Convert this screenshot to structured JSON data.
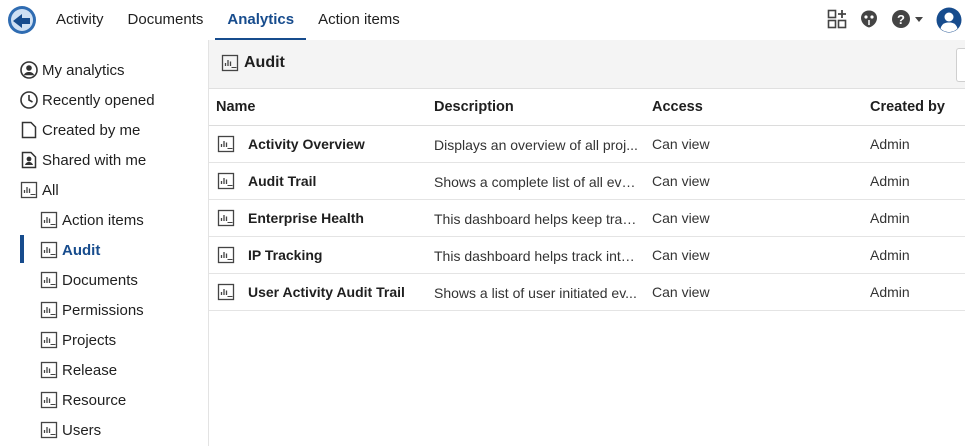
{
  "nav": {
    "tabs": [
      {
        "label": "Activity"
      },
      {
        "label": "Documents"
      },
      {
        "label": "Analytics"
      },
      {
        "label": "Action items"
      }
    ],
    "active_tab": "Analytics"
  },
  "sidebar": {
    "items": [
      {
        "label": "My analytics",
        "icon": "person-circle-icon"
      },
      {
        "label": "Recently opened",
        "icon": "clock-icon"
      },
      {
        "label": "Created by me",
        "icon": "document-icon"
      },
      {
        "label": "Shared with me",
        "icon": "shared-document-icon"
      },
      {
        "label": "All",
        "icon": "dashboard-icon"
      },
      {
        "label": "Action items",
        "icon": "dashboard-icon"
      },
      {
        "label": "Audit",
        "icon": "dashboard-icon"
      },
      {
        "label": "Documents",
        "icon": "dashboard-icon"
      },
      {
        "label": "Permissions",
        "icon": "dashboard-icon"
      },
      {
        "label": "Projects",
        "icon": "dashboard-icon"
      },
      {
        "label": "Release",
        "icon": "dashboard-icon"
      },
      {
        "label": "Resource",
        "icon": "dashboard-icon"
      },
      {
        "label": "Users",
        "icon": "dashboard-icon"
      }
    ],
    "active_item": "Audit"
  },
  "main": {
    "title": "Audit",
    "columns": [
      "Name",
      "Description",
      "Access",
      "Created by"
    ],
    "rows": [
      {
        "name": "Activity Overview",
        "description": "Displays an overview of all proj...",
        "access": "Can view",
        "created_by": "Admin"
      },
      {
        "name": "Audit Trail",
        "description": "Shows a complete list of all eve...",
        "access": "Can view",
        "created_by": "Admin"
      },
      {
        "name": "Enterprise Health",
        "description": "This dashboard helps keep trac...",
        "access": "Can view",
        "created_by": "Admin"
      },
      {
        "name": "IP Tracking",
        "description": "This dashboard helps track inte...",
        "access": "Can view",
        "created_by": "Admin"
      },
      {
        "name": "User Activity Audit Trail",
        "description": "Shows a list of user initiated ev...",
        "access": "Can view",
        "created_by": "Admin"
      }
    ]
  },
  "colors": {
    "accent": "#174c8d",
    "header_bg": "#f4f4f4",
    "avatar": "#174c8d"
  }
}
